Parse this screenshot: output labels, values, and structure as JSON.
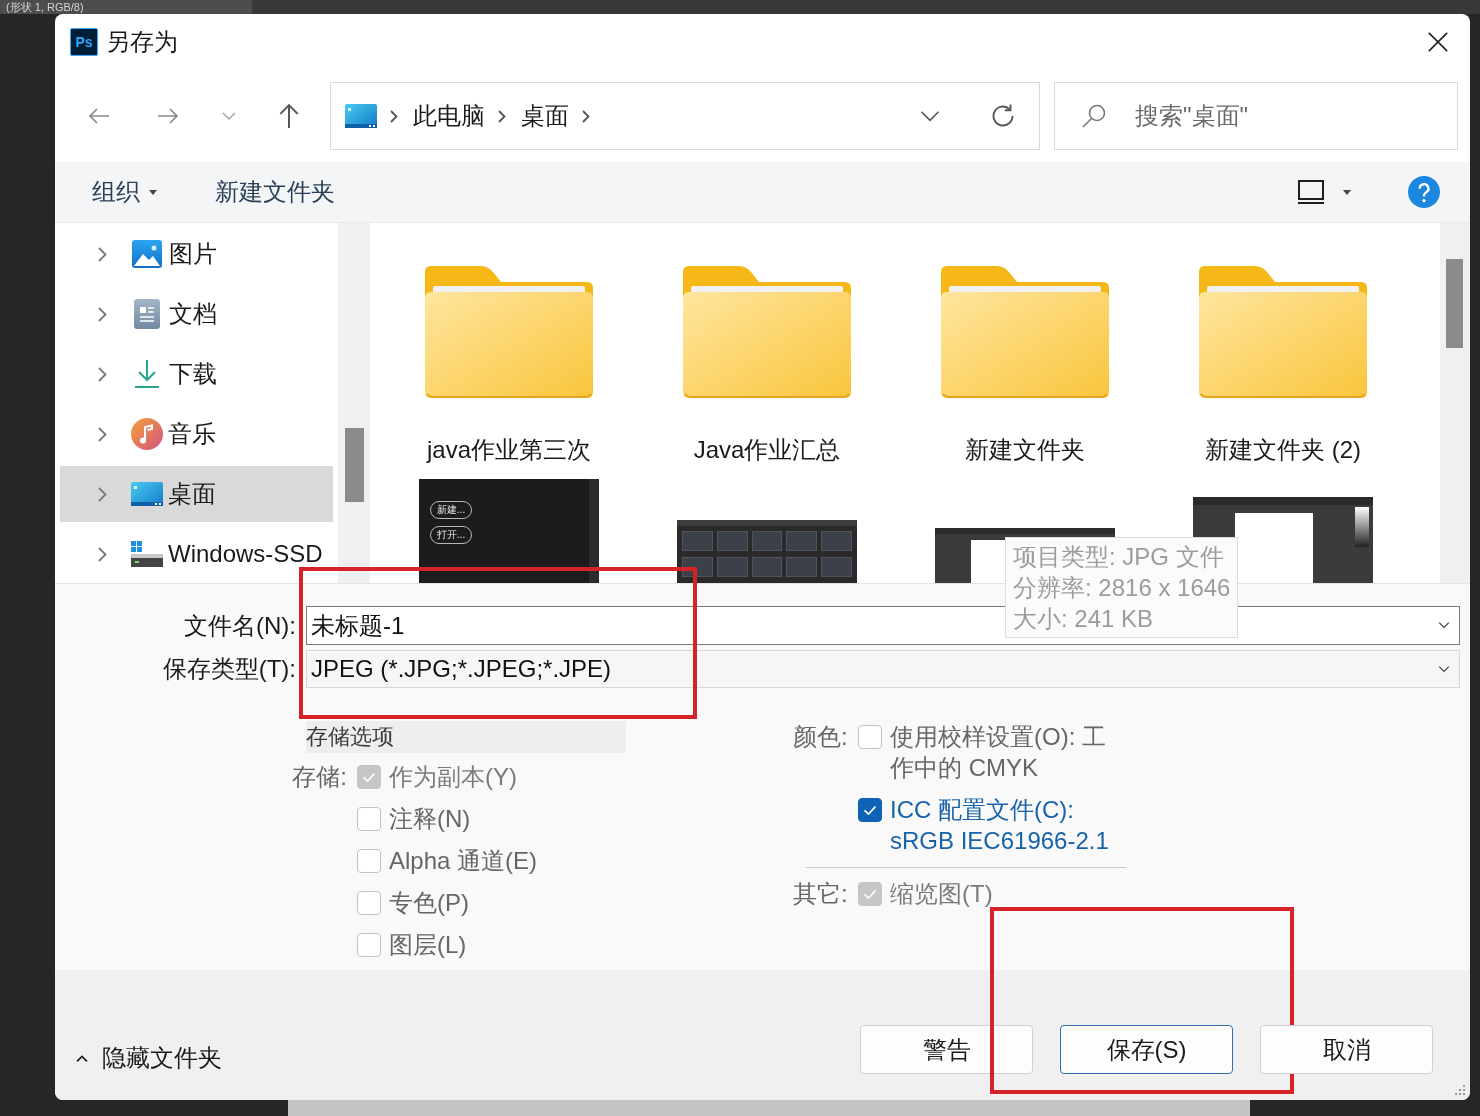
{
  "background": {
    "document_tab": "(形状 1, RGB/8)"
  },
  "window": {
    "app_badge": "Ps",
    "title": "另存为"
  },
  "navigation": {
    "path": [
      "此电脑",
      "桌面"
    ],
    "search": {
      "placeholder": "搜索\"桌面\""
    }
  },
  "toolbar": {
    "organize": "组织",
    "new_folder": "新建文件夹"
  },
  "sidebar": {
    "items": [
      {
        "label": "图片",
        "selected": false
      },
      {
        "label": "文档",
        "selected": false
      },
      {
        "label": "下载",
        "selected": false
      },
      {
        "label": "音乐",
        "selected": false
      },
      {
        "label": "桌面",
        "selected": true
      },
      {
        "label": "Windows-SSD",
        "selected": false
      }
    ]
  },
  "files": {
    "folders": [
      {
        "name": "java作业第三次"
      },
      {
        "name": "Java作业汇总"
      },
      {
        "name": "新建文件夹"
      },
      {
        "name": "新建文件夹 (2)"
      }
    ],
    "images": [
      {
        "kind": "start-screen",
        "labels": [
          "新建...",
          "打开..."
        ]
      },
      {
        "kind": "grid-screen"
      },
      {
        "kind": "editor-wide"
      },
      {
        "kind": "editor-tall"
      }
    ]
  },
  "tooltip": {
    "lines": [
      "项目类型: JPG 文件",
      "分辨率: 2816 x 1646",
      "大小: 241 KB"
    ]
  },
  "save_form": {
    "filename_label": "文件名(N):",
    "filename": "未标题-1",
    "type_label": "保存类型(T):",
    "type": "JPEG (*.JPG;*.JPEG;*.JPE)",
    "framed": true
  },
  "options": {
    "title": "存储选项",
    "groups": [
      {
        "label": "存储:",
        "items": [
          {
            "label": "作为副本(Y)",
            "checked": true,
            "disabled": true
          },
          {
            "label": "注释(N)",
            "checked": false,
            "disabled": false
          },
          {
            "label": "Alpha 通道(E)",
            "checked": false,
            "disabled": false
          },
          {
            "label": "专色(P)",
            "checked": false,
            "disabled": false
          },
          {
            "label": "图层(L)",
            "checked": false,
            "disabled": false
          }
        ]
      },
      {
        "label": "颜色:",
        "items": [
          {
            "label": "使用校样设置(O): 工作中的 CMYK",
            "checked": false,
            "disabled": false
          },
          {
            "label": "ICC 配置文件(C): sRGB IEC61966-2.1",
            "checked": true,
            "disabled": false
          }
        ]
      },
      {
        "label": "其它:",
        "items": [
          {
            "label": "缩览图(T)",
            "checked": true,
            "disabled": true
          }
        ]
      }
    ]
  },
  "footer": {
    "toggle": "隐藏文件夹",
    "buttons": [
      {
        "label": "警告",
        "default": false,
        "framed": false
      },
      {
        "label": "保存(S)",
        "default": true,
        "framed": true
      },
      {
        "label": "取消",
        "default": false,
        "framed": false
      }
    ]
  }
}
